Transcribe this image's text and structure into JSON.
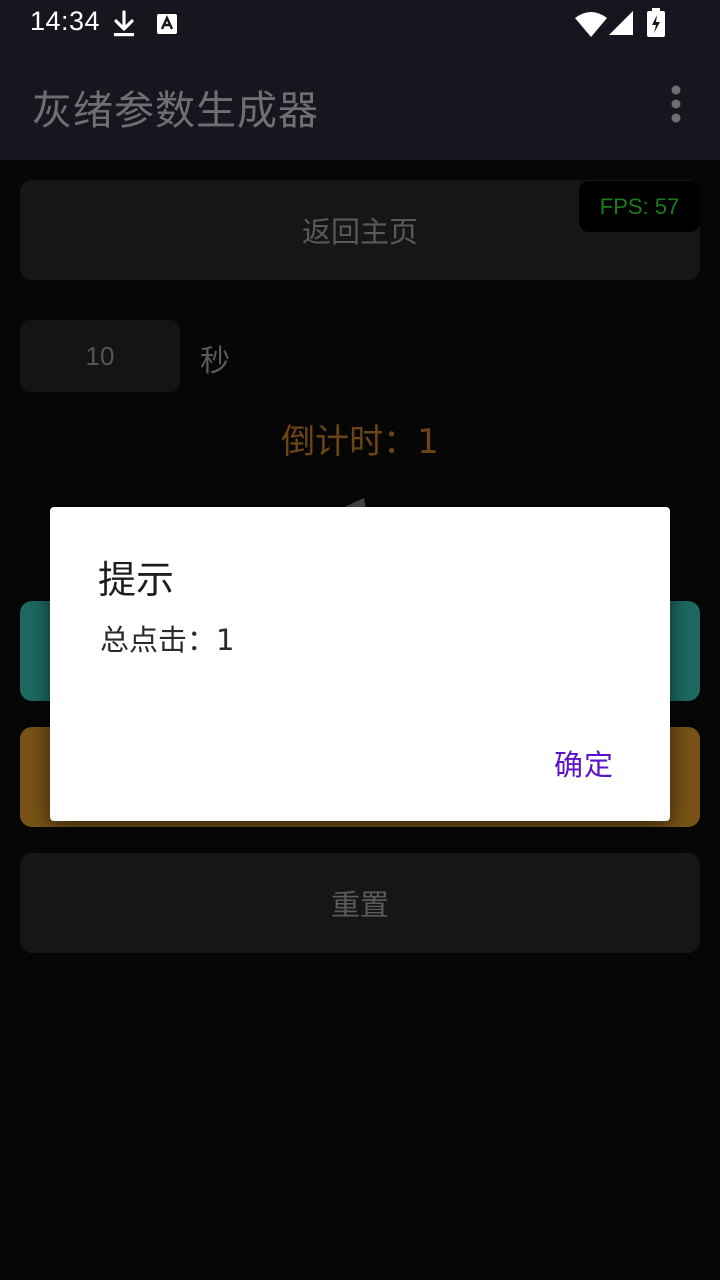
{
  "status_bar": {
    "time": "14:34",
    "icons": [
      "download-icon",
      "keyboard-a-icon",
      "wifi-icon",
      "signal-icon",
      "battery-charging-icon"
    ]
  },
  "app_bar": {
    "title": "灰绪参数生成器",
    "menu_icon": "overflow-menu-icon"
  },
  "main": {
    "back_button_label": "返回主页",
    "fps_label": "FPS: 57",
    "seconds_value": "10",
    "seconds_unit": "秒",
    "countdown_text": "倒计时：1",
    "reset_button_label": "重置"
  },
  "dialog": {
    "title": "提示",
    "message": "总点击：1",
    "confirm_label": "确定"
  },
  "colors": {
    "background": "#060606",
    "app_bar": "#16161f",
    "accent_green": "#1e6a63",
    "accent_orange": "#7a5416",
    "fps_text": "#1d7a1d",
    "dialog_button": "#5a14c8"
  }
}
